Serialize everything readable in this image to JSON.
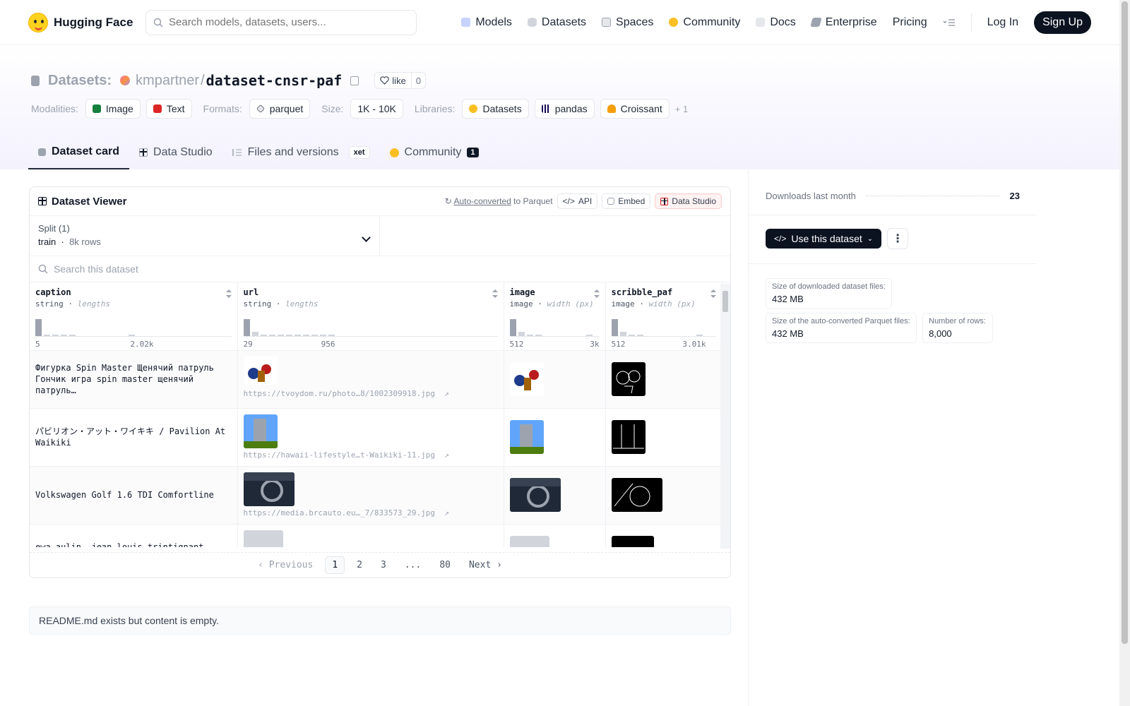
{
  "nav": {
    "brand": "Hugging Face",
    "search_placeholder": "Search models, datasets, users...",
    "links": [
      {
        "label": "Models",
        "icon": "models-icon"
      },
      {
        "label": "Datasets",
        "icon": "datasets-icon"
      },
      {
        "label": "Spaces",
        "icon": "spaces-icon"
      },
      {
        "label": "Community",
        "icon": "community-icon"
      },
      {
        "label": "Docs",
        "icon": "docs-icon"
      },
      {
        "label": "Enterprise",
        "icon": "enterprise-icon"
      },
      {
        "label": "Pricing",
        "icon": ""
      }
    ],
    "login": "Log In",
    "signup": "Sign Up"
  },
  "header": {
    "section": "Datasets:",
    "owner": "kmpartner",
    "sep": "/",
    "name": "dataset-cnsr-paf",
    "like_label": "like",
    "like_count": "0",
    "modalities_label": "Modalities:",
    "modalities": [
      "Image",
      "Text"
    ],
    "formats_label": "Formats:",
    "formats": [
      "parquet"
    ],
    "size_label": "Size:",
    "size": "1K - 10K",
    "libraries_label": "Libraries:",
    "libraries": [
      "Datasets",
      "pandas",
      "Croissant"
    ],
    "libraries_more": "+ 1"
  },
  "tabs": {
    "card": "Dataset card",
    "studio": "Data Studio",
    "files": "Files and versions",
    "xet": "xet",
    "community": "Community",
    "community_count": "1"
  },
  "viewer": {
    "title": "Dataset Viewer",
    "autoconv_link": "Auto-converted",
    "autoconv_rest": "to Parquet",
    "api": "API",
    "embed": "Embed",
    "studio": "Data Studio",
    "split_label": "Split (1)",
    "split_name": "train",
    "split_rows": "8k rows",
    "search_placeholder": "Search this dataset",
    "columns": [
      {
        "name": "caption",
        "type": "string",
        "stat": "lengths",
        "min": "5",
        "max": "2.02k"
      },
      {
        "name": "url",
        "type": "string",
        "stat": "lengths",
        "min": "29",
        "max": "956"
      },
      {
        "name": "image",
        "type": "image",
        "stat": "width (px)",
        "min": "512",
        "max": "3k"
      },
      {
        "name": "scribble_paf",
        "type": "image",
        "stat": "width (px)",
        "min": "512",
        "max": "3.01k"
      }
    ],
    "rows": [
      {
        "caption": "Фигурка Spin Master Щенячий патруль Гончик игра spin master щенячий патруль…",
        "url": "https://tvoydom.ru/photo…8/1002309918.jpg"
      },
      {
        "caption": "パビリオン・アット・ワイキキ / Pavilion At Waikiki",
        "url": "https://hawaii-lifestyle…t-Waikiki-11.jpg"
      },
      {
        "caption": "Volkswagen Golf 1.6 TDI Comfortline",
        "url": "https://media.brcauto.eu…_7/833573_29.jpg"
      },
      {
        "caption": "ewa aulin, jean-louis trintignant, with",
        "url": ""
      }
    ],
    "pager": {
      "prev": "Previous",
      "pages": [
        "1",
        "2",
        "3",
        "...",
        "80"
      ],
      "next": "Next"
    }
  },
  "readme": "README.md exists but content is empty.",
  "sidebar": {
    "downloads_label": "Downloads last month",
    "downloads": "23",
    "use_btn": "Use this dataset",
    "stat1_k": "Size of downloaded dataset files:",
    "stat1_v": "432 MB",
    "stat2_k": "Size of the auto-converted Parquet files:",
    "stat2_v": "432 MB",
    "stat3_k": "Number of rows:",
    "stat3_v": "8,000"
  }
}
